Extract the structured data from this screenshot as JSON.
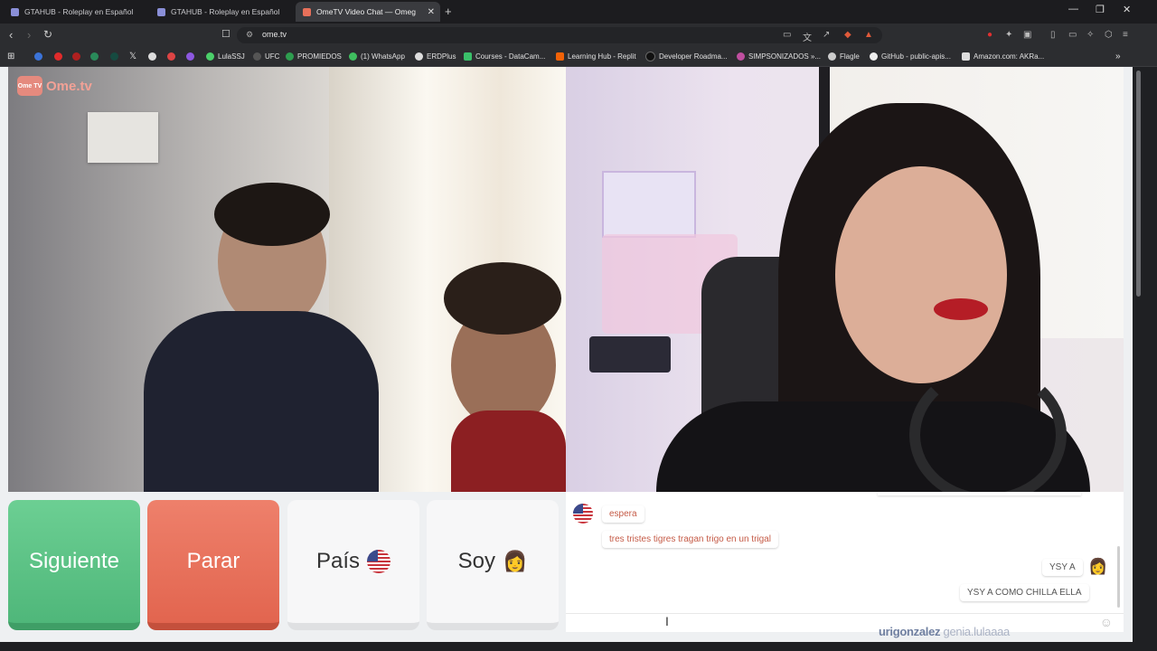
{
  "browser": {
    "tabs": [
      {
        "title": "GTAHUB - Roleplay en Español",
        "active": false
      },
      {
        "title": "GTAHUB - Roleplay en Español",
        "active": false
      },
      {
        "title": "OmeTV Video Chat — Omeg",
        "active": true
      }
    ],
    "url": "ome.tv",
    "bookmarks": [
      "LulaSSJ",
      "UFC",
      "PROMIEDOS",
      "(1) WhatsApp",
      "ERDPlus",
      "Courses - DataCam...",
      "Learning Hub - Replit",
      "Developer Roadma...",
      "SIMPSONIZADOS »...",
      "Flagle",
      "GitHub - public-apis...",
      "Amazon.com: AKRa..."
    ]
  },
  "logo": {
    "badge": "Ome TV",
    "text": "Ome.tv"
  },
  "controls": {
    "next_label": "Siguiente",
    "stop_label": "Parar",
    "country_label": "País",
    "gender_label": "Soy",
    "gender_emoji": "👩"
  },
  "chat": {
    "messages": [
      {
        "from": "stranger",
        "text": "espera"
      },
      {
        "from": "stranger",
        "text": "tres tristes tigres tragan trigo en un trigal"
      },
      {
        "from": "me",
        "text": "YSY A"
      },
      {
        "from": "me",
        "text": "YSY A COMO CHILLA ELLA"
      }
    ],
    "me_emoji": "👩"
  },
  "watermark": {
    "name": "urigonzalez",
    "sub": "genia.lulaaaa"
  },
  "colors": {
    "next": "#5cc384",
    "stop": "#e8705a",
    "stranger_text": "#c55b47"
  }
}
